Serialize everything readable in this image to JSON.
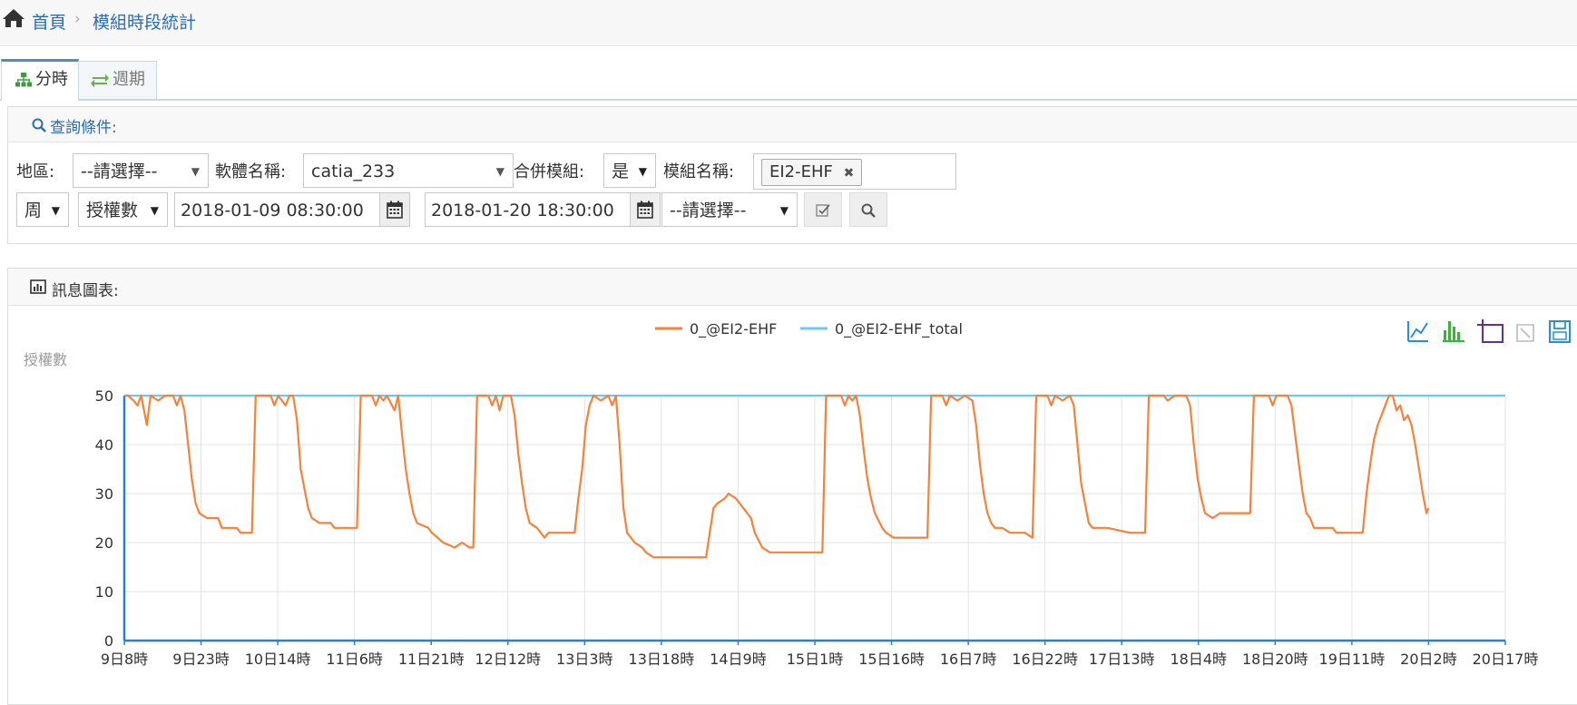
{
  "breadcrumb": {
    "home": "首頁",
    "current": "模組時段統計",
    "separator": "›"
  },
  "tabs": [
    {
      "label": "分時",
      "active": true
    },
    {
      "label": "週期",
      "active": false
    }
  ],
  "query_panel": {
    "title": "查詢條件:",
    "region_label": "地區:",
    "region_value": "--請選擇--",
    "software_label": "軟體名稱:",
    "software_value": "catia_233",
    "merge_label": "合併模組:",
    "merge_value": "是",
    "module_label": "模組名稱:",
    "module_tag": "EI2-EHF",
    "tag_remove": "✖",
    "period_value": "周",
    "metric_value": "授權數",
    "start_time": "2018-01-09 08:30:00",
    "end_time": "2018-01-20 18:30:00",
    "extra_select": "--請選擇--"
  },
  "chart_panel": {
    "title": "訊息圖表:"
  },
  "chart_data": {
    "type": "line",
    "ylabel": "授權數",
    "ylim": [
      0,
      50
    ],
    "yticks": [
      0,
      10,
      20,
      30,
      40,
      50
    ],
    "xticks": [
      "9日8時",
      "9日23時",
      "10日14時",
      "11日6時",
      "11日21時",
      "12日12時",
      "13日3時",
      "13日18時",
      "14日9時",
      "15日1時",
      "15日16時",
      "16日7時",
      "16日22時",
      "17日13時",
      "18日4時",
      "18日20時",
      "19日11時",
      "20日2時",
      "20日17時"
    ],
    "x_hours_range": [
      0,
      368
    ],
    "series": [
      {
        "name": "0_@EI2-EHF",
        "color": "#f5813a",
        "points": [
          [
            0,
            50
          ],
          [
            1,
            50
          ],
          [
            2.5,
            49
          ],
          [
            3.5,
            48
          ],
          [
            4.5,
            50
          ],
          [
            6,
            44
          ],
          [
            7,
            50
          ],
          [
            9,
            49
          ],
          [
            11,
            50
          ],
          [
            13,
            50
          ],
          [
            14,
            48
          ],
          [
            15,
            50
          ],
          [
            16,
            47
          ],
          [
            17,
            40
          ],
          [
            18,
            33
          ],
          [
            19,
            28
          ],
          [
            20,
            26
          ],
          [
            22,
            25
          ],
          [
            25,
            25
          ],
          [
            26,
            23
          ],
          [
            30,
            23
          ],
          [
            31,
            22
          ],
          [
            33,
            22
          ],
          [
            34,
            22
          ],
          [
            35,
            50
          ],
          [
            39,
            50
          ],
          [
            40,
            48
          ],
          [
            41,
            50
          ],
          [
            42,
            49
          ],
          [
            43,
            48
          ],
          [
            44,
            50
          ],
          [
            45,
            50
          ],
          [
            46,
            45
          ],
          [
            47,
            35
          ],
          [
            48,
            31
          ],
          [
            49,
            27
          ],
          [
            50,
            25
          ],
          [
            52,
            24
          ],
          [
            55,
            24
          ],
          [
            56,
            23
          ],
          [
            62,
            23
          ],
          [
            63,
            50
          ],
          [
            66,
            50
          ],
          [
            67,
            48
          ],
          [
            68,
            50
          ],
          [
            69,
            49
          ],
          [
            70,
            50
          ],
          [
            72,
            47
          ],
          [
            73,
            50
          ],
          [
            74,
            42
          ],
          [
            75,
            35
          ],
          [
            76,
            30
          ],
          [
            77,
            26
          ],
          [
            78,
            24
          ],
          [
            81,
            23
          ],
          [
            82,
            22
          ],
          [
            85,
            20
          ],
          [
            88,
            19
          ],
          [
            90,
            20
          ],
          [
            92,
            19
          ],
          [
            93,
            19
          ],
          [
            94,
            50
          ],
          [
            97,
            50
          ],
          [
            98,
            48
          ],
          [
            99,
            50
          ],
          [
            100,
            47
          ],
          [
            101,
            50
          ],
          [
            103,
            50
          ],
          [
            104,
            46
          ],
          [
            105,
            38
          ],
          [
            106,
            32
          ],
          [
            107,
            27
          ],
          [
            108,
            24
          ],
          [
            110,
            23
          ],
          [
            112,
            21
          ],
          [
            113,
            22
          ],
          [
            116,
            22
          ],
          [
            120,
            22
          ],
          [
            121,
            29
          ],
          [
            122,
            35
          ],
          [
            123,
            44
          ],
          [
            124,
            48
          ],
          [
            125,
            50
          ],
          [
            127,
            49
          ],
          [
            129,
            50
          ],
          [
            130,
            48
          ],
          [
            131,
            50
          ],
          [
            132,
            40
          ],
          [
            133,
            27
          ],
          [
            134,
            22
          ],
          [
            136,
            20
          ],
          [
            138,
            19
          ],
          [
            139,
            18
          ],
          [
            141,
            17
          ],
          [
            150,
            17
          ],
          [
            155,
            17
          ],
          [
            156,
            22
          ],
          [
            157,
            27
          ],
          [
            158,
            28
          ],
          [
            160,
            29
          ],
          [
            161,
            30
          ],
          [
            163,
            29
          ],
          [
            165,
            27
          ],
          [
            167,
            25
          ],
          [
            168,
            22
          ],
          [
            170,
            19
          ],
          [
            172,
            18
          ],
          [
            180,
            18
          ],
          [
            186,
            18
          ],
          [
            187,
            50
          ],
          [
            191,
            50
          ],
          [
            192,
            48
          ],
          [
            193,
            50
          ],
          [
            194,
            49
          ],
          [
            195,
            50
          ],
          [
            196,
            46
          ],
          [
            197,
            39
          ],
          [
            198,
            33
          ],
          [
            199,
            29
          ],
          [
            200,
            26
          ],
          [
            202,
            23
          ],
          [
            203,
            22
          ],
          [
            205,
            21
          ],
          [
            210,
            21
          ],
          [
            214,
            21
          ],
          [
            215,
            50
          ],
          [
            218,
            50
          ],
          [
            219,
            48
          ],
          [
            220,
            50
          ],
          [
            222,
            49
          ],
          [
            224,
            50
          ],
          [
            226,
            49
          ],
          [
            227,
            44
          ],
          [
            228,
            36
          ],
          [
            229,
            30
          ],
          [
            230,
            26
          ],
          [
            231,
            24
          ],
          [
            232,
            23
          ],
          [
            234,
            23
          ],
          [
            236,
            22
          ],
          [
            240,
            22
          ],
          [
            242,
            21
          ],
          [
            243,
            50
          ],
          [
            246,
            50
          ],
          [
            247,
            48
          ],
          [
            248,
            50
          ],
          [
            250,
            49
          ],
          [
            252,
            50
          ],
          [
            253,
            48
          ],
          [
            254,
            40
          ],
          [
            255,
            32
          ],
          [
            256,
            28
          ],
          [
            257,
            24
          ],
          [
            258,
            23
          ],
          [
            262,
            23
          ],
          [
            268,
            22
          ],
          [
            272,
            22
          ],
          [
            273,
            50
          ],
          [
            277,
            50
          ],
          [
            278,
            49
          ],
          [
            280,
            50
          ],
          [
            283,
            50
          ],
          [
            284,
            48
          ],
          [
            285,
            40
          ],
          [
            286,
            33
          ],
          [
            287,
            29
          ],
          [
            288,
            26
          ],
          [
            290,
            25
          ],
          [
            292,
            26
          ],
          [
            300,
            26
          ],
          [
            301,
            50
          ],
          [
            305,
            50
          ],
          [
            306,
            48
          ],
          [
            307,
            50
          ],
          [
            310,
            50
          ],
          [
            311,
            48
          ],
          [
            312,
            42
          ],
          [
            313,
            36
          ],
          [
            314,
            30
          ],
          [
            315,
            26
          ],
          [
            316,
            25
          ],
          [
            317,
            23
          ],
          [
            322,
            23
          ],
          [
            323,
            22
          ],
          [
            330,
            22
          ],
          [
            331,
            30
          ],
          [
            332,
            36
          ],
          [
            333,
            41
          ],
          [
            334,
            44
          ],
          [
            335,
            46
          ],
          [
            336,
            48
          ],
          [
            337,
            50
          ],
          [
            338,
            50
          ],
          [
            339,
            47
          ],
          [
            340,
            48
          ],
          [
            341,
            45
          ],
          [
            342,
            46
          ],
          [
            343,
            44
          ],
          [
            344,
            40
          ],
          [
            345,
            35
          ],
          [
            346,
            30
          ],
          [
            347,
            26
          ],
          [
            347.5,
            27
          ]
        ]
      },
      {
        "name": "0_@EI2-EHF_total",
        "color": "#6ec8f0",
        "points": [
          [
            0,
            50
          ],
          [
            368,
            50
          ]
        ]
      }
    ],
    "legend_position": "top-center",
    "grid": true
  },
  "chart_icons": [
    "line-chart-icon",
    "bar-chart-icon",
    "crop-zoom-icon",
    "restore-icon",
    "save-image-icon"
  ],
  "colors": {
    "accent": "#2b6cb0",
    "series1": "#f5813a",
    "series2": "#6ec8f0"
  }
}
